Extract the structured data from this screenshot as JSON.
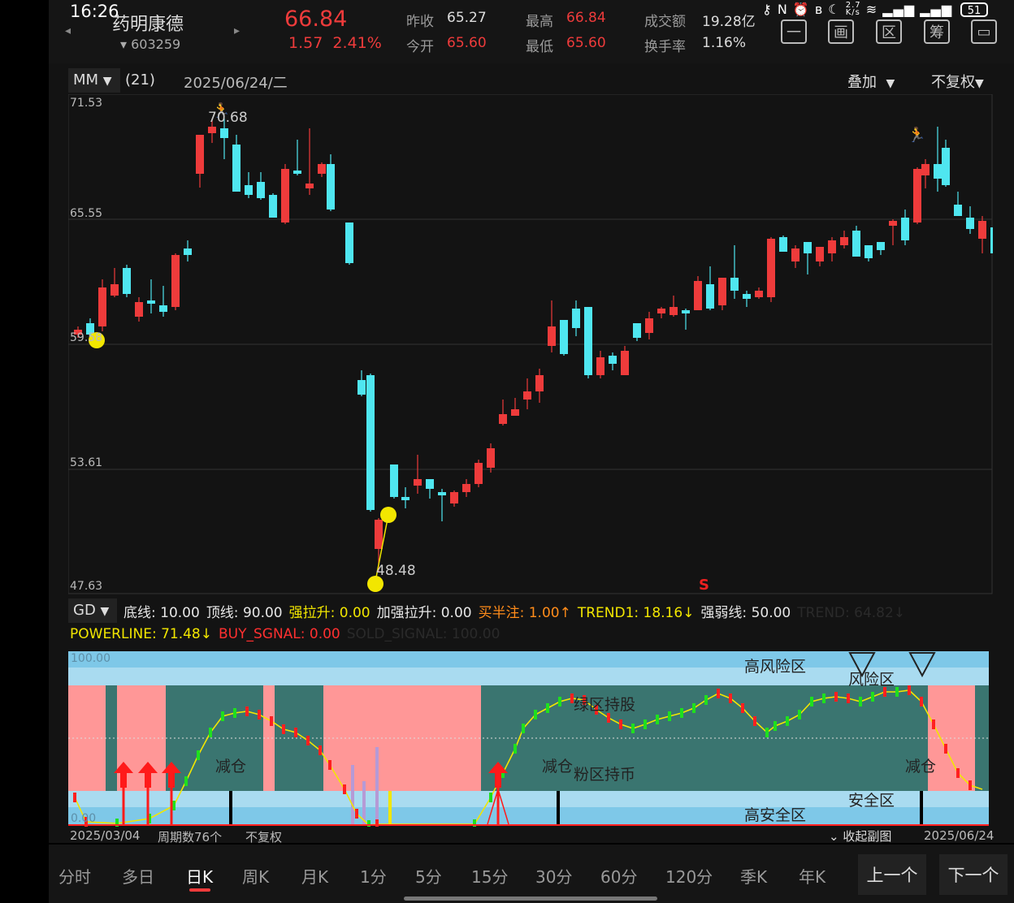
{
  "status": {
    "time": "16:26",
    "net_speed_top": "2.7",
    "net_speed_unit": "K/s",
    "battery": "51"
  },
  "stock": {
    "name": "药明康德",
    "code": "603259",
    "price": "66.84",
    "change": "1.57",
    "change_pct": "2.41%"
  },
  "quote": {
    "prev_close_label": "昨收",
    "prev_close": "65.27",
    "open_label": "今开",
    "open": "65.60",
    "high_label": "最高",
    "high": "66.84",
    "low_label": "最低",
    "low": "65.60",
    "amount_label": "成交额",
    "amount": "19.28亿",
    "turnover_label": "换手率",
    "turnover": "1.16%"
  },
  "header_buttons": [
    {
      "name": "minus-icon",
      "glyph": "一"
    },
    {
      "name": "draw-icon",
      "glyph": "画"
    },
    {
      "name": "range-icon",
      "glyph": "区"
    },
    {
      "name": "chip-icon",
      "glyph": "筹"
    },
    {
      "name": "multi-window-icon",
      "glyph": "▭"
    }
  ],
  "toolbar": {
    "indicator": "MM",
    "period": "(21)",
    "date": "2025/06/24/二",
    "overlay": "叠加",
    "adjust": "不复权"
  },
  "main_axis": {
    "top": "71.53",
    "mid1": "65.55",
    "mid2": "59.58",
    "mid3": "53.61",
    "bottom": "47.63"
  },
  "annotations": {
    "high_mark": "70.68",
    "low_mark": "48.48",
    "sell_mark": "S"
  },
  "sub_indicator": {
    "name": "GD",
    "line1": [
      {
        "text": "底线: 10.00",
        "color": "#e6e6e6"
      },
      {
        "text": "顶线: 90.00",
        "color": "#e6e6e6"
      },
      {
        "text": "强拉升: 0.00",
        "color": "#f2e600"
      },
      {
        "text": "加强拉升: 0.00",
        "color": "#e6e6e6"
      },
      {
        "text": "买半注: 1.00↑",
        "color": "#ff8c1a"
      },
      {
        "text": "TREND1: 18.16↓",
        "color": "#f2e600"
      },
      {
        "text": "强弱线: 50.00",
        "color": "#e6e6e6"
      },
      {
        "text": "TREND: 64.82↓",
        "color": "#2a2a2a"
      }
    ],
    "line2": [
      {
        "text": "POWERLINE: 71.48↓",
        "color": "#f2e600"
      },
      {
        "text": "BUY_SGNAL: 0.00",
        "color": "#ff3030"
      },
      {
        "text": "SOLD_SIGNAL: 100.00",
        "color": "#2a2a2a"
      }
    ]
  },
  "sub_chart": {
    "top_label": "100.00",
    "bottom_label": "0.00",
    "zones": {
      "high_risk": "高风险区",
      "risk": "风险区",
      "green_hold": "绿区持股",
      "reduce1": "减仓",
      "reduce2": "减仓",
      "reduce3": "减仓",
      "pink_hold": "粉区持币",
      "safe": "安全区",
      "high_safe": "高安全区"
    }
  },
  "footer": {
    "start_date": "2025/03/04",
    "period_count": "周期数76个",
    "adjust": "不复权",
    "collapse": "收起副图",
    "end_date": "2025/06/24"
  },
  "tabs": [
    "分时",
    "多日",
    "日K",
    "周K",
    "月K",
    "1分",
    "5分",
    "15分",
    "30分",
    "60分",
    "120分",
    "季K",
    "年K"
  ],
  "active_tab": "日K",
  "nav": {
    "prev": "上一个",
    "next": "下一个"
  },
  "colors": {
    "up": "#ee3b3b",
    "down": "#4fe6f0",
    "risk_blue": "#7ec8e8",
    "green_zone": "#3a7570",
    "pink_zone": "#ff9797",
    "yellow": "#f2e600"
  }
}
